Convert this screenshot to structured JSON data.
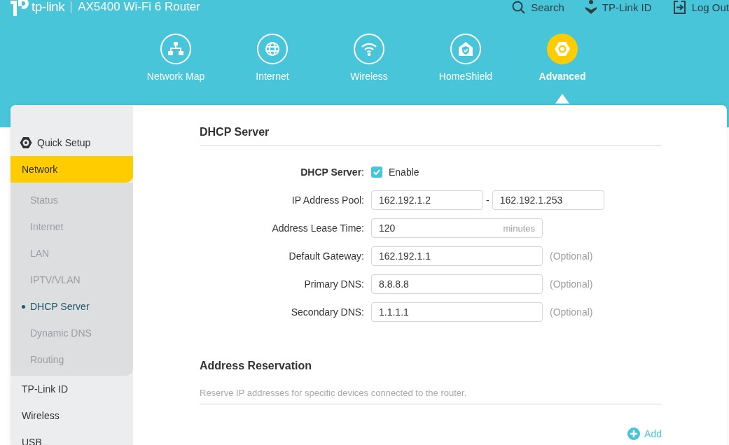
{
  "header": {
    "brand": "tp-link",
    "product": "AX5400 Wi-Fi 6 Router",
    "actions": [
      "Search",
      "TP-Link ID",
      "Log Out"
    ]
  },
  "nav": [
    {
      "label": "Network Map",
      "selected": false
    },
    {
      "label": "Internet",
      "selected": false
    },
    {
      "label": "Wireless",
      "selected": false
    },
    {
      "label": "HomeShield",
      "selected": false
    },
    {
      "label": "Advanced",
      "selected": true
    }
  ],
  "sidebar": {
    "items": [
      {
        "label": "Quick Setup",
        "kind": "setup",
        "selected": false
      },
      {
        "label": "Network",
        "kind": "menu",
        "selected": true,
        "expanded": true,
        "children": [
          {
            "label": "Status",
            "selected": false
          },
          {
            "label": "Internet",
            "selected": false
          },
          {
            "label": "LAN",
            "selected": false
          },
          {
            "label": "IPTV/VLAN",
            "selected": false
          },
          {
            "label": "DHCP Server",
            "selected": true
          },
          {
            "label": "Dynamic DNS",
            "selected": false
          },
          {
            "label": "Routing",
            "selected": false
          }
        ]
      },
      {
        "label": "TP-Link ID",
        "kind": "menu",
        "selected": false
      },
      {
        "label": "Wireless",
        "kind": "menu",
        "selected": false
      },
      {
        "label": "USB",
        "kind": "menu",
        "selected": false
      }
    ]
  },
  "dhcp_server": {
    "title": "DHCP Server",
    "rows": [
      {
        "kind": "toggle",
        "label": "**DHCP Server**:",
        "checked": true,
        "option": "Enable"
      },
      {
        "kind": "range",
        "label": "IP Address Pool:",
        "from": "162.192.1.2",
        "separator": "-",
        "to": "162.192.1.253"
      },
      {
        "kind": "unit",
        "label": "Address Lease Time:",
        "value": "120",
        "unit": "minutes"
      },
      {
        "kind": "text",
        "label": "Default Gateway:",
        "value": "162.192.1.1",
        "note": "(Optional)"
      },
      {
        "kind": "text",
        "label": "Primary DNS:",
        "value": "8.8.8.8",
        "note": "(Optional)"
      },
      {
        "kind": "text",
        "label": "Secondary DNS:",
        "value": "1.1.1.1",
        "note": "(Optional)"
      }
    ]
  },
  "address_reservation": {
    "title": "Address Reservation",
    "description": "Reserve IP addresses for specific devices connected to the router.",
    "add_button": "Add"
  }
}
